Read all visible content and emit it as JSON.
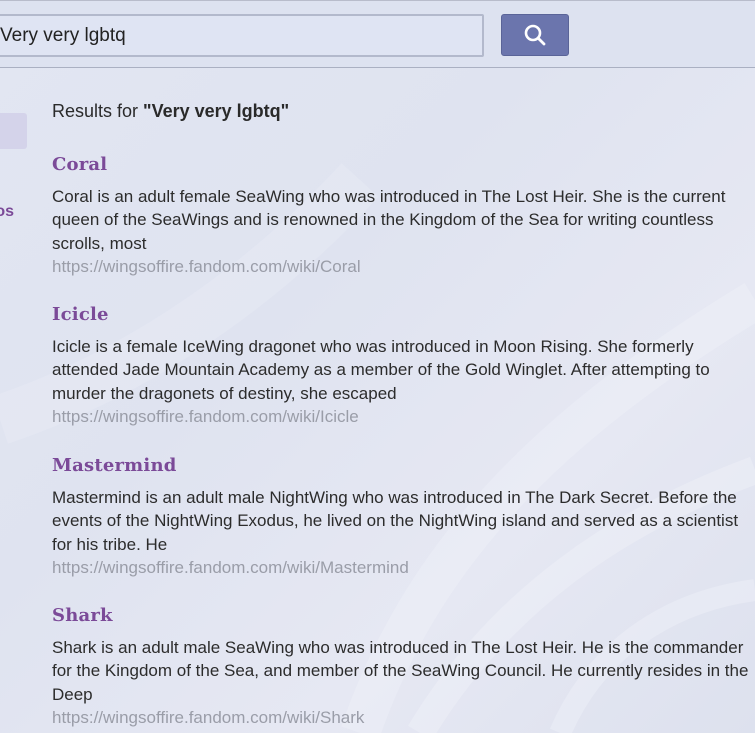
{
  "search": {
    "query": "Very very lgbtq",
    "button_icon": "search-icon"
  },
  "sidebar": {
    "partial_text": "os"
  },
  "results_header": {
    "prefix": "Results for ",
    "query_quoted": "\"Very very lgbtq\""
  },
  "results": [
    {
      "title": "Coral",
      "snippet": "Coral is an adult female SeaWing who was introduced in The Lost Heir. She is the current queen of the SeaWings and is renowned in the Kingdom of the Sea for writing countless scrolls, most",
      "url": "https://wingsoffire.fandom.com/wiki/Coral"
    },
    {
      "title": "Icicle",
      "snippet": "Icicle is a female IceWing dragonet who was introduced in Moon Rising. She formerly attended Jade Mountain Academy as a member of the Gold Winglet. After attempting to murder the dragonets of destiny, she escaped",
      "url": "https://wingsoffire.fandom.com/wiki/Icicle"
    },
    {
      "title": "Mastermind",
      "snippet": "Mastermind is an adult male NightWing who was introduced in The Dark Secret. Before the events of the NightWing Exodus, he lived on the NightWing island and served as a scientist for his tribe. He",
      "url": "https://wingsoffire.fandom.com/wiki/Mastermind"
    },
    {
      "title": "Shark",
      "snippet": "Shark is an adult male SeaWing who was introduced in The Lost Heir. He is the commander for the Kingdom of the Sea, and member of the SeaWing Council. He currently resides in the Deep",
      "url": "https://wingsoffire.fandom.com/wiki/Shark"
    }
  ],
  "colors": {
    "title_link": "#7b4a98",
    "search_button": "#6b75ad",
    "url_text": "#9a9da8"
  }
}
